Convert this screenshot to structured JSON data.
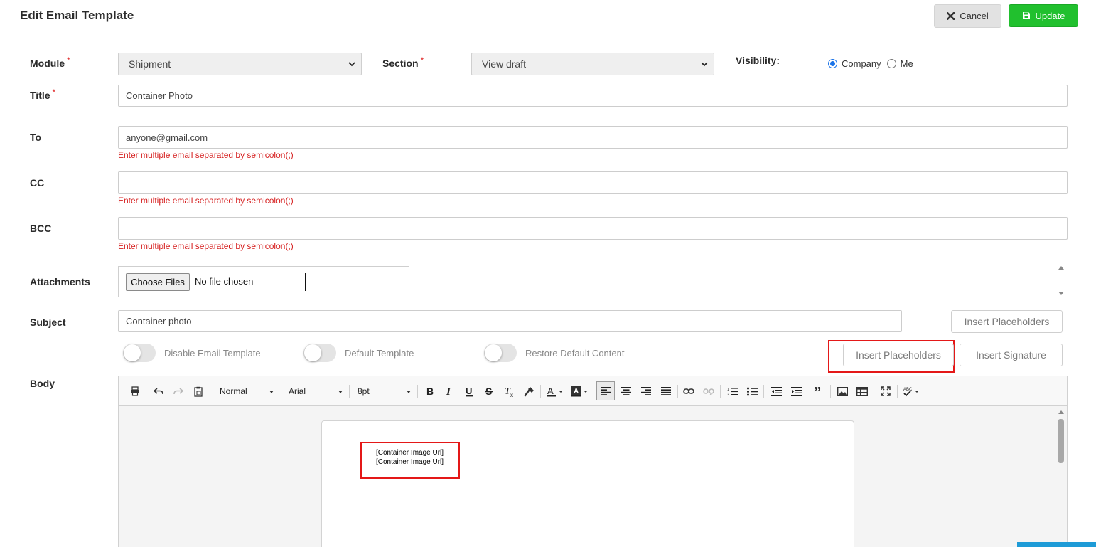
{
  "header": {
    "title": "Edit Email Template",
    "cancel_label": "Cancel",
    "update_label": "Update"
  },
  "form": {
    "module": {
      "label": "Module",
      "required_mark": "*",
      "value": "Shipment"
    },
    "section": {
      "label": "Section",
      "required_mark": "*",
      "value": "View draft"
    },
    "visibility": {
      "label": "Visibility:",
      "options": [
        "Company",
        "Me"
      ],
      "selected": "Company"
    },
    "title": {
      "label": "Title",
      "required_mark": "*",
      "value": "Container Photo"
    },
    "to": {
      "label": "To",
      "value": "anyone@gmail.com",
      "hint": "Enter multiple email separated by semicolon(;)"
    },
    "cc": {
      "label": "CC",
      "value": "",
      "hint": "Enter multiple email separated by semicolon(;)"
    },
    "bcc": {
      "label": "BCC",
      "value": "",
      "hint": "Enter multiple email separated by semicolon(;)"
    },
    "attachments": {
      "label": "Attachments",
      "choose_label": "Choose Files",
      "status": "No file chosen"
    },
    "subject": {
      "label": "Subject",
      "value": "Container photo",
      "insert_placeholders_label": "Insert Placeholders"
    },
    "toggles": {
      "disable_email_template": {
        "label": "Disable Email Template",
        "on": false
      },
      "default_template": {
        "label": "Default Template",
        "on": false
      },
      "restore_default_content": {
        "label": "Restore Default Content",
        "on": false
      }
    },
    "body": {
      "label": "Body",
      "insert_placeholders_label": "Insert Placeholders",
      "insert_signature_label": "Insert Signature"
    }
  },
  "editor": {
    "format_block": "Normal",
    "font_name": "Arial",
    "font_size": "8pt",
    "content_lines": [
      "[Container Image Url]",
      "[Container Image Url]"
    ]
  },
  "colors": {
    "update_green": "#21c02e",
    "hint_red": "#d62020",
    "highlight_red": "#e41818",
    "radio_blue": "#1a73e8"
  },
  "icons": [
    "close-icon",
    "save-icon",
    "chevron-down-icon",
    "print-icon",
    "undo-icon",
    "redo-icon",
    "paste-icon",
    "bold-icon",
    "italic-icon",
    "underline-icon",
    "strikethrough-icon",
    "remove-format-icon",
    "format-painter-icon",
    "text-color-icon",
    "background-color-icon",
    "align-left-icon",
    "align-center-icon",
    "align-right-icon",
    "align-justify-icon",
    "link-icon",
    "unlink-icon",
    "numbered-list-icon",
    "bullet-list-icon",
    "outdent-icon",
    "indent-icon",
    "blockquote-icon",
    "image-icon",
    "table-icon",
    "fullscreen-icon",
    "spellcheck-icon"
  ]
}
